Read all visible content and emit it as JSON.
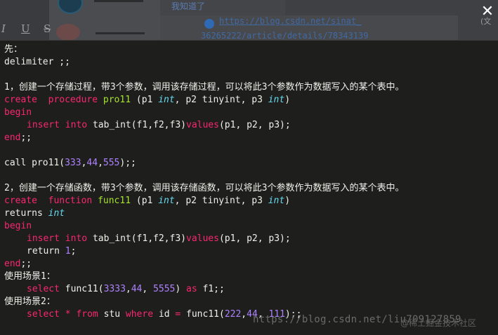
{
  "background_page": {
    "notice_text": "我知道了",
    "link_line1": "https://blog.csdn.net/sinat_",
    "link_line2": "36265222/article/details/78343139",
    "toolbar": [
      "I",
      "U",
      "S"
    ],
    "right_edge_text": "(文"
  },
  "viewer": {
    "close_label": "✕"
  },
  "code": {
    "l1": "先：",
    "l2": "delimiter ;;",
    "l3": "1，创建一个存储过程，带3个参数，调用该存储过程，可以将此3个参数作为数据写入的某个表中。",
    "l4": {
      "kw1": "create",
      "kw2": "procedure",
      "name": "pro11",
      "p1": "(p1 ",
      "t1": "int",
      "p2": ", p2 tinyint, p3 ",
      "t2": "int",
      "close": ")"
    },
    "l5": "begin",
    "l6": {
      "kw1": "insert",
      "kw2": "into",
      "tbl": "tab_int(f1,f2,f3)",
      "kw3": "values",
      "args": "(p1, p2, p3);"
    },
    "l7": {
      "kw": "end",
      "rest": ";;"
    },
    "l8": {
      "pre": "call pro11(",
      "n1": "333",
      "c1": ",",
      "n2": "44",
      "c2": ",",
      "n3": "555",
      "post": ");;"
    },
    "l9": "2，创建一个存储函数，带3个参数，调用该存储函数，可以将此3个参数作为数据写入的某个表中。",
    "l10": {
      "kw1": "create",
      "kw2": "function",
      "name": "func11",
      "p1": "(p1 ",
      "t1": "int",
      "p2": ", p2 tinyint, p3 ",
      "t2": "int",
      "close": ")"
    },
    "l11": {
      "kw": "returns",
      "type": "int"
    },
    "l12": "begin",
    "l13": {
      "kw1": "insert",
      "kw2": "into",
      "tbl": "tab_int(f1,f2,f3)",
      "kw3": "values",
      "args": "(p1, p2, p3);"
    },
    "l14": {
      "kw": "return",
      "num": "1",
      "post": ";"
    },
    "l15": {
      "kw": "end",
      "rest": ";;"
    },
    "l16": "使用场景1：",
    "l17": {
      "kw1": "select",
      "pre": "func11(",
      "n1": "3333",
      "c1": ",",
      "n2": "44",
      "c2": ", ",
      "n3": "5555",
      "post": ") ",
      "kw2": "as",
      "alias": "f1;;"
    },
    "l18": "使用场景2：",
    "l19": {
      "kw1": "select",
      "star": "*",
      "kw2": "from",
      "tbl": "stu",
      "kw3": "where",
      "cond": "id",
      "eq": "=",
      "pre": "func11(",
      "n1": "222",
      "c1": ",",
      "n2": "44",
      "c2": ", ",
      "n3": "111",
      "post": ");;"
    }
  },
  "watermark": {
    "url": "https://blog.csdn.net/liu709127859",
    "brand": "@稀土掘金技术社区"
  },
  "colors": {
    "background": "#1e1f1c",
    "text": "#f0f0ea",
    "keyword": "#f92672",
    "function_name": "#a6e22e",
    "type": "#66d9ef",
    "number": "#ae81ff"
  }
}
